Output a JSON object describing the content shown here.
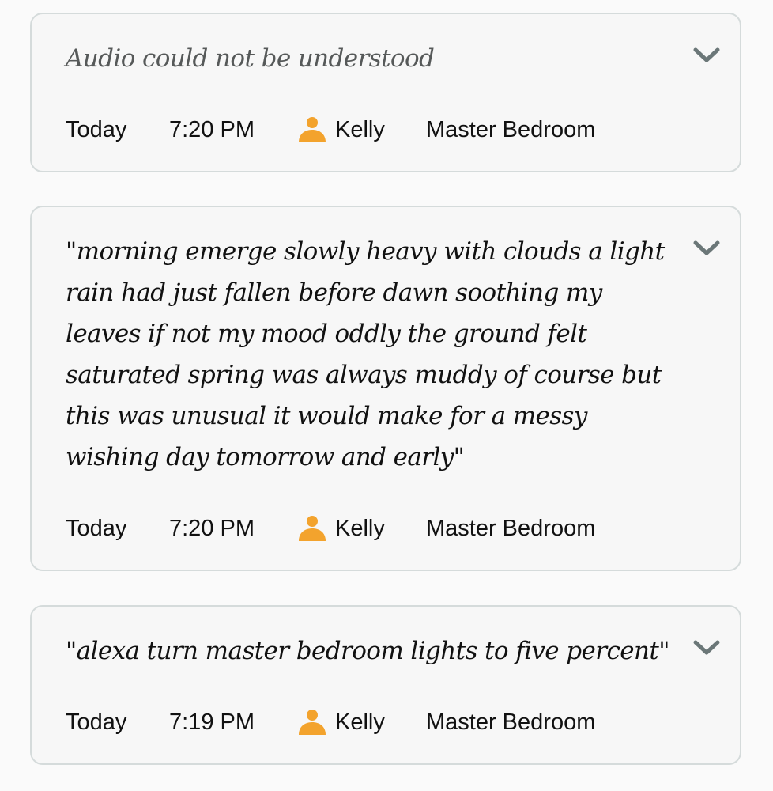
{
  "colors": {
    "card_border": "#d5dbdb",
    "card_background": "#f7f7f7",
    "page_background": "#fafafa",
    "person_icon": "#f3a32d",
    "chevron": "#6b7778",
    "muted_text": "#565959"
  },
  "icons": {
    "expand": "chevron-down-icon",
    "user": "person-icon"
  },
  "history": [
    {
      "transcript": "Audio could not be understood",
      "date": "Today",
      "time": "7:20 PM",
      "user": "Kelly",
      "device": "Master Bedroom"
    },
    {
      "transcript": "\"morning emerge slowly heavy with clouds a light rain had just fallen before dawn soothing my leaves if not my mood oddly the ground felt saturated spring was always muddy of course but this was unusual it would make for a messy wishing day tomorrow and early\"",
      "date": "Today",
      "time": "7:20 PM",
      "user": "Kelly",
      "device": "Master Bedroom"
    },
    {
      "transcript": "\"alexa turn master bedroom lights to five percent\"",
      "date": "Today",
      "time": "7:19 PM",
      "user": "Kelly",
      "device": "Master Bedroom"
    }
  ]
}
